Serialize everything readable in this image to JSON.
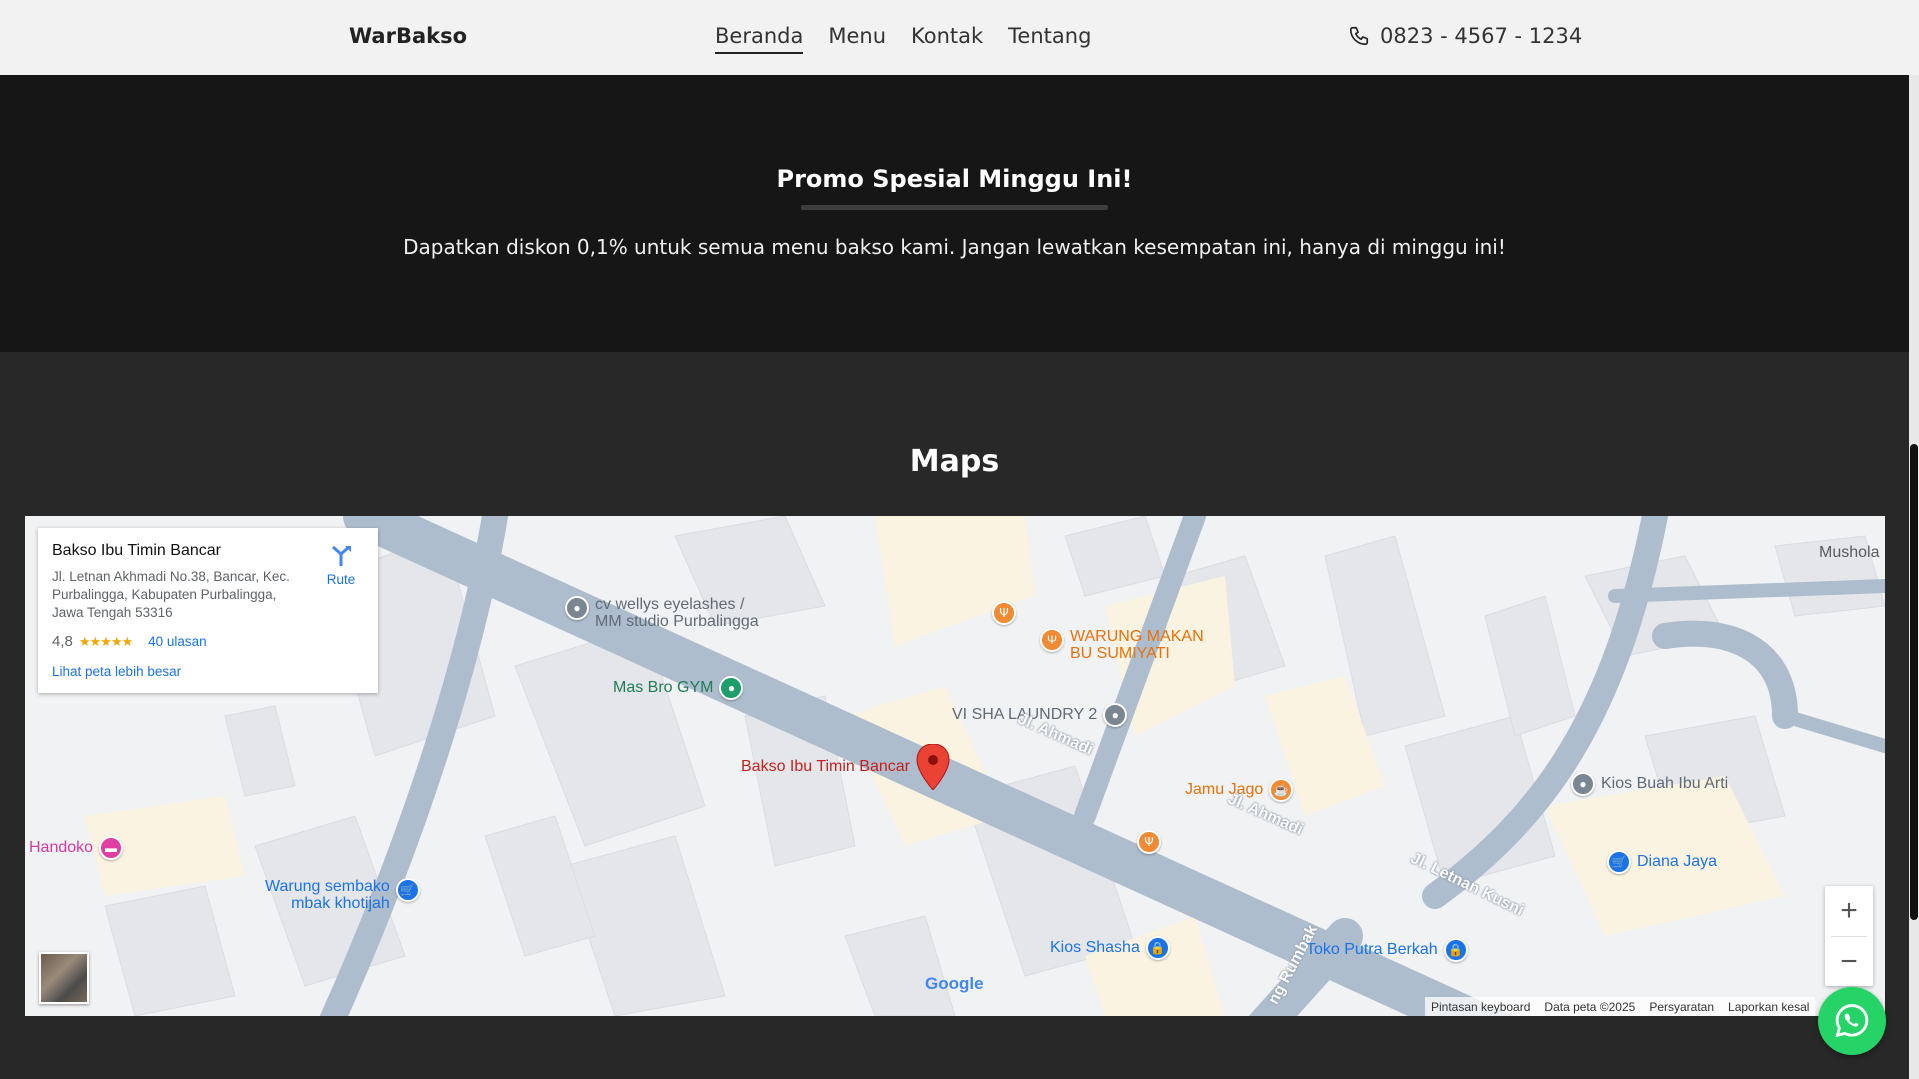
{
  "navbar": {
    "brand": "WarBakso",
    "links": [
      {
        "label": "Beranda",
        "active": true
      },
      {
        "label": "Menu",
        "active": false
      },
      {
        "label": "Kontak",
        "active": false
      },
      {
        "label": "Tentang",
        "active": false
      }
    ],
    "phone": "0823 - 4567 - 1234",
    "phone_icon": "phone-icon"
  },
  "promo": {
    "title": "Promo Spesial Minggu Ini!",
    "text": "Dapatkan diskon 0,1% untuk semua menu bakso kami. Jangan lewatkan kesempatan ini, hanya di minggu ini!"
  },
  "maps": {
    "title": "Maps",
    "info_card": {
      "name": "Bakso Ibu Timin Bancar",
      "address": "Jl. Letnan Akhmadi No.38, Bancar, Kec. Purbalingga, Kabupaten Purbalingga, Jawa Tengah 53316",
      "rating": "4,8",
      "stars": "★★★★★",
      "reviews": "40 ulasan",
      "larger_map": "Lihat peta lebih besar",
      "route": "Rute"
    },
    "places": {
      "cv_wellys_1": "cv wellys eyelashes /",
      "cv_wellys_2": "MM studio Purbalingga",
      "mas_bro_gym": "Mas Bro GYM",
      "warung_makan_1": "WARUNG MAKAN",
      "warung_makan_2": "BU SUMIYATI",
      "visha_laundry": "VI SHA LAUNDRY 2",
      "bakso_pin": "Bakso Ibu Timin Bancar",
      "jamu_jago": "Jamu Jago",
      "handoko": "Handoko",
      "warung_sembako_1": "Warung sembako",
      "warung_sembako_2": "mbak khotijah",
      "kios_buah": "Kios Buah Ibu Arti",
      "diana_jaya": "Diana Jaya",
      "kios_shasha": "Kios Shasha",
      "toko_putra": "Toko Putra Berkah",
      "mushola": "Mushola"
    },
    "roads": {
      "jl_ahmadi": "Jl. Ahmadi",
      "jl_letnan_kusni": "Jl. Letnan Kusni",
      "jl_rumbak": "ng Rumbak"
    },
    "zoom_in": "+",
    "zoom_out": "−",
    "google": "Google",
    "attribution": [
      "Pintasan keyboard",
      "Data peta ©2025",
      "Persyaratan",
      "Laporkan kesal"
    ]
  },
  "colors": {
    "promo_bg": "#161616",
    "maps_bg": "#282828",
    "whatsapp": "#25d366",
    "road": "#aebdcd"
  }
}
